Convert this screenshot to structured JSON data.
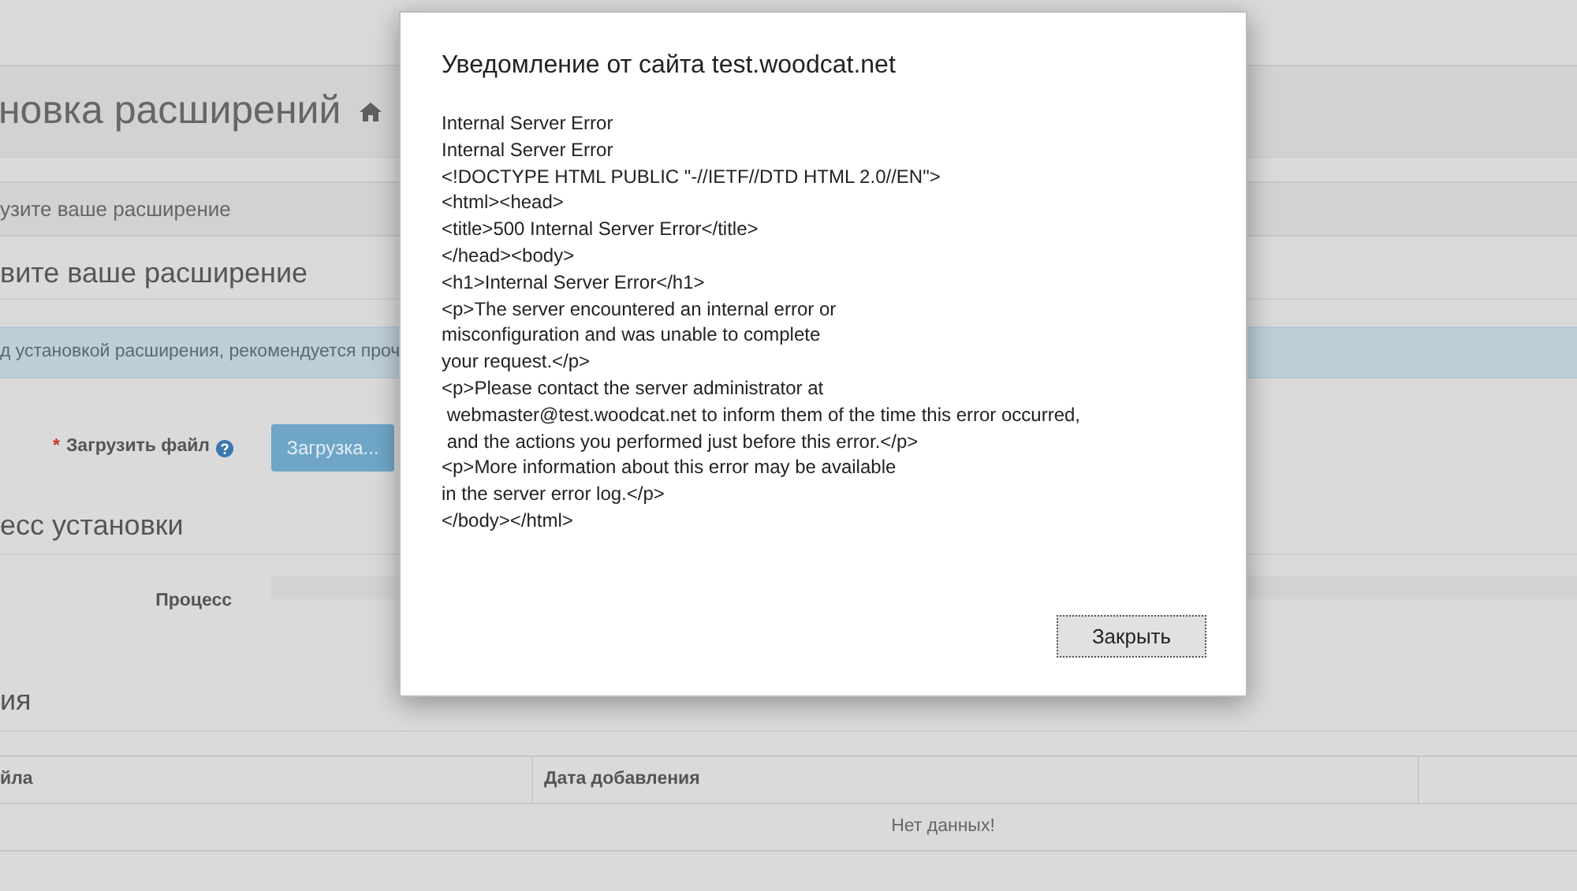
{
  "page": {
    "title": "новка расширений",
    "breadcrumb": "узите ваше расширение",
    "upload_section": {
      "heading": "вите ваше расширение",
      "alert": "д установкой расширения, рекомендуется проч",
      "field_label": "Загрузить файл",
      "required_mark": "*",
      "button": "Загрузка..."
    },
    "progress_section": {
      "heading": "есс установки",
      "label": "Процесс",
      "level": 0
    },
    "history_section": {
      "heading": "ия",
      "table": {
        "columns": [
          "йла",
          "Дата добавления"
        ],
        "empty_text": "Нет данных!"
      }
    }
  },
  "dialog": {
    "title": "Уведомление от сайта test.woodcat.net",
    "lines": [
      "Internal Server Error",
      "Internal Server Error",
      "<!DOCTYPE HTML PUBLIC \"-//IETF//DTD HTML 2.0//EN\">",
      "<html><head>",
      "<title>500 Internal Server Error</title>",
      "</head><body>",
      "<h1>Internal Server Error</h1>",
      "<p>The server encountered an internal error or",
      "misconfiguration and was unable to complete",
      "your request.</p>",
      "<p>Please contact the server administrator at",
      " webmaster@test.woodcat.net to inform them of the time this error occurred,",
      " and the actions you performed just before this error.</p>",
      "<p>More information about this error may be available",
      "in the server error log.</p>",
      "</body></html>"
    ],
    "button": "Закрыть"
  }
}
